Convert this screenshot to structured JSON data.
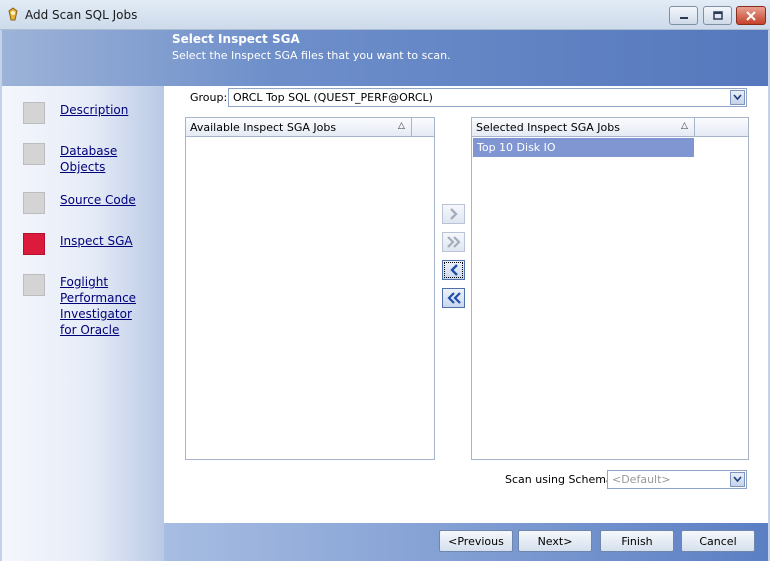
{
  "window": {
    "title": "Add Scan SQL Jobs",
    "app_icon": "database-wizard-icon",
    "controls": [
      "minimize-icon",
      "maximize-icon",
      "close-icon"
    ]
  },
  "header": {
    "title": "Select Inspect SGA",
    "subtitle": "Select the Inspect SGA files that you want to scan."
  },
  "sidebar": {
    "items": [
      {
        "label": "Description",
        "active": false
      },
      {
        "label": "Database Objects",
        "active": false
      },
      {
        "label": "Source Code",
        "active": false
      },
      {
        "label": "Inspect SGA",
        "active": true
      },
      {
        "label": "Foglight Performance Investigator for Oracle",
        "active": false
      }
    ]
  },
  "group": {
    "label": "Group:",
    "value": "ORCL Top SQL (QUEST_PERF@ORCL)"
  },
  "available_list": {
    "header": "Available Inspect SGA Jobs",
    "items": []
  },
  "selected_list": {
    "header": "Selected Inspect SGA Jobs",
    "items": [
      "Top 10 Disk IO"
    ]
  },
  "move_buttons": [
    {
      "icon": "chevron-right-icon",
      "enabled": false
    },
    {
      "icon": "double-chevron-right-icon",
      "enabled": false
    },
    {
      "icon": "chevron-left-icon",
      "enabled": true
    },
    {
      "icon": "double-chevron-left-icon",
      "enabled": true
    }
  ],
  "schema": {
    "label": "Scan using Schema:",
    "value": "<Default>"
  },
  "footer": {
    "previous": "<Previous",
    "next": "Next>",
    "finish": "Finish",
    "cancel": "Cancel"
  },
  "colors": {
    "header_blue": "#5578bd",
    "active_step": "#dc1a3c",
    "selection": "#7f96d2",
    "link": "#00007a"
  }
}
